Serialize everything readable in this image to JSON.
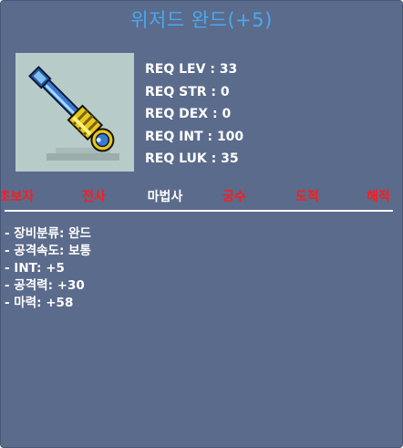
{
  "item": {
    "title": "위저드 완드(+5)",
    "icon": "wizard-wand-icon"
  },
  "requirements": [
    "REQ LEV : 33",
    "REQ STR : 0",
    "REQ DEX : 0",
    "REQ INT : 100",
    "REQ LUK : 35"
  ],
  "jobs": [
    {
      "label": "초보자",
      "allowed": false
    },
    {
      "label": "전사",
      "allowed": false
    },
    {
      "label": "마법사",
      "allowed": true
    },
    {
      "label": "궁수",
      "allowed": false
    },
    {
      "label": "도적",
      "allowed": false
    },
    {
      "label": "해적",
      "allowed": false
    }
  ],
  "colors": {
    "background": "#5b6b8c",
    "title": "#4aa8f0",
    "not_allowed_job": "#ff1a1a",
    "allowed_job": "#ffffff"
  },
  "stats": [
    "- 장비분류: 완드",
    "- 공격속도: 보통",
    "- INT: +5",
    "- 공격력: +30",
    "- 마력: +58"
  ]
}
